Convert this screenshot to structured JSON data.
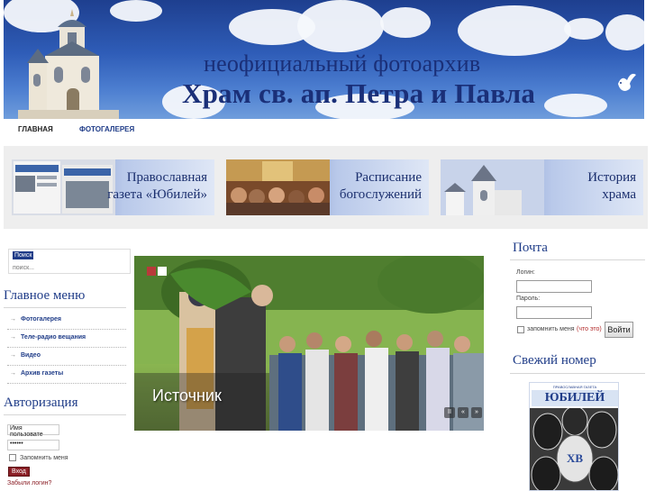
{
  "header": {
    "subtitle": "неофициальный фотоархив",
    "title": "Храм св. ап. Петра и Павла"
  },
  "topnav": {
    "items": [
      "ГЛАВНАЯ",
      "ФОТОГАЛЕРЕЯ"
    ]
  },
  "promos": [
    {
      "line1": "Православная",
      "line2": "газета «Юбилей»"
    },
    {
      "line1": "Расписание",
      "line2": "богослужений"
    },
    {
      "line1": "История",
      "line2": "храма"
    }
  ],
  "search": {
    "label": "Поиск",
    "placeholder": "поиск..."
  },
  "main_menu": {
    "title": "Главное меню",
    "items": [
      "Фотогалерея",
      "Теле-радио вещания",
      "Видео",
      "Архив газеты"
    ]
  },
  "auth": {
    "title": "Авторизация",
    "username_value": "Имя пользовате",
    "password_value": "••••••",
    "remember_label": "Запомнить меня",
    "submit_label": "Вход",
    "forgot_label": "Забыли логин?"
  },
  "slideshow": {
    "caption": "Источник",
    "controls": [
      "II",
      "«",
      "»"
    ]
  },
  "mail": {
    "title": "Почта",
    "login_label": "Логин:",
    "password_label": "Пароль:",
    "remember_label": "запомнить меня",
    "what_is_it": "(что это)",
    "submit_label": "Войти"
  },
  "fresh_issue": {
    "title": "Свежий номер",
    "paper_header": "ЮБИЛЕЙ",
    "paper_top": "ПРАВОСЛАВНАЯ ГАЗЕТА",
    "paper_mark": "ХВ"
  },
  "colors": {
    "brand_blue": "#1f3c88",
    "accent_red": "#8b1f26"
  }
}
